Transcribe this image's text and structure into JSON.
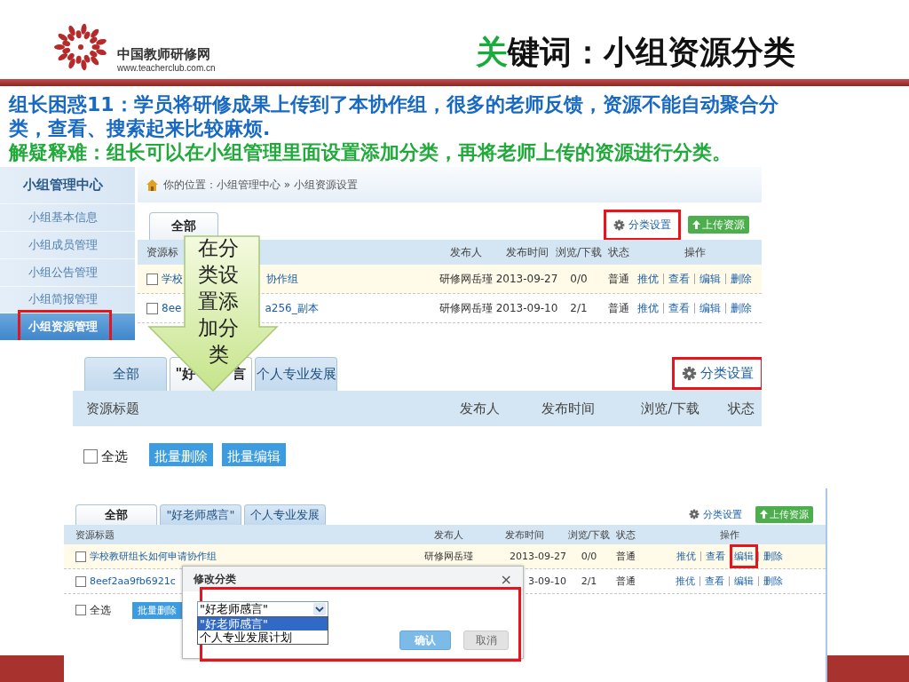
{
  "logo": {
    "name": "中国教师研修网",
    "url": "www.teacherclub.com.cn"
  },
  "title": {
    "highlight": "关",
    "rest": "键词：小组资源分类"
  },
  "notes": [
    {
      "kind": "problem",
      "text": "组长困惑11：学员将研修成果上传到了本协作组，很多的老师反馈，资源不能自动聚合分类，查看、搜索起来比较麻烦."
    },
    {
      "kind": "solution",
      "text": "解疑释难：组长可以在小组管理里面设置添加分类，再将老师上传的资源进行分类。"
    }
  ],
  "shot1": {
    "sidebar": {
      "title": "小组管理中心",
      "items": [
        {
          "label": "小组基本信息",
          "selected": false,
          "highlighted": false
        },
        {
          "label": "小组成员管理",
          "selected": false,
          "highlighted": false
        },
        {
          "label": "小组公告管理",
          "selected": false,
          "highlighted": false
        },
        {
          "label": "小组简报管理",
          "selected": false,
          "highlighted": false
        },
        {
          "label": "小组资源管理",
          "selected": true,
          "highlighted": true
        }
      ]
    },
    "breadcrumb": "你的位置：小组管理中心 » 小组资源设置",
    "tabs": [
      {
        "label_parts": [
          "全部"
        ],
        "selected": true
      }
    ],
    "category_link": {
      "label": "分类设置",
      "highlighted": true
    },
    "upload_button": "上传资源",
    "columns": [
      "资源标",
      "发布人",
      "发布时间",
      "浏览/下载",
      "状态",
      "操作"
    ],
    "rows": [
      {
        "checked": false,
        "hovered": true,
        "title_parts": [
          "学校",
          "协作组"
        ],
        "publisher": "研修网岳瑾",
        "date": "2013-09-27",
        "views": "0/0",
        "status": "普通",
        "actions": [
          {
            "label": "推优",
            "highlighted": false
          },
          {
            "label": "查看",
            "highlighted": false
          },
          {
            "label": "编辑",
            "highlighted": false
          },
          {
            "label": "删除",
            "highlighted": false
          }
        ]
      },
      {
        "checked": false,
        "hovered": false,
        "title_parts": [
          "8ee",
          "a256_副本"
        ],
        "publisher": "研修网岳瑾",
        "date": "2013-09-10",
        "views": "2/1",
        "status": "普通",
        "actions": [
          {
            "label": "推优",
            "highlighted": false
          },
          {
            "label": "查看",
            "highlighted": false
          },
          {
            "label": "编辑",
            "highlighted": false
          },
          {
            "label": "删除",
            "highlighted": false
          }
        ]
      }
    ]
  },
  "shot2": {
    "tabs": [
      {
        "label_parts": [
          "全部"
        ],
        "selected": false
      },
      {
        "label_parts": [
          "\"好",
          "言"
        ],
        "selected": true
      },
      {
        "label_parts": [
          "个人专业发展"
        ],
        "selected": false
      }
    ],
    "category_link": {
      "label": "分类设置",
      "highlighted": true
    },
    "columns": [
      "资源标题",
      "发布人",
      "发布时间",
      "浏览/下载",
      "状态"
    ],
    "select_all": {
      "label": "全选",
      "checked": false
    },
    "bulk_buttons": [
      "批量删除",
      "批量编辑"
    ]
  },
  "shot3": {
    "tabs": [
      {
        "label_parts": [
          "全部"
        ],
        "selected": true
      },
      {
        "label_parts": [
          "\"好老师感言\""
        ],
        "selected": false
      },
      {
        "label_parts": [
          "个人专业发展"
        ],
        "selected": false
      }
    ],
    "category_link": {
      "label": "分类设置",
      "highlighted": false
    },
    "upload_button": "上传资源",
    "columns": [
      "资源标题",
      "发布人",
      "发布时间",
      "浏览/下载",
      "状态",
      "操作"
    ],
    "rows": [
      {
        "checked": false,
        "hovered": true,
        "title": "学校教研组长如何申请协作组",
        "publisher": "研修网岳瑾",
        "date": "2013-09-27",
        "views": "0/0",
        "status": "普通",
        "actions": [
          {
            "label": "推优",
            "highlighted": false
          },
          {
            "label": "查看",
            "highlighted": false
          },
          {
            "label": "编辑",
            "highlighted": true
          },
          {
            "label": "删除",
            "highlighted": false
          }
        ]
      },
      {
        "checked": false,
        "hovered": false,
        "title": "8eef2aa9fb6921c",
        "date": "3-09-10",
        "views": "2/1",
        "status": "普通",
        "actions": [
          {
            "label": "推优",
            "highlighted": false
          },
          {
            "label": "查看",
            "highlighted": false
          },
          {
            "label": "编辑",
            "highlighted": false
          },
          {
            "label": "删除",
            "highlighted": false
          }
        ]
      }
    ],
    "select_all": {
      "label": "全选",
      "checked": false
    },
    "bulk_buttons": [
      "批量删除"
    ],
    "dialog": {
      "title": "修改分类",
      "close": "×",
      "highlighted": true,
      "select": {
        "value": "\"好老师感言\"",
        "options": [
          {
            "label": "\"好老师感言\"",
            "selected": true
          },
          {
            "label": "个人专业发展计划",
            "selected": false
          }
        ]
      },
      "buttons": [
        {
          "label": "确认",
          "kind": "primary"
        },
        {
          "label": "取消",
          "kind": "secondary"
        }
      ]
    }
  },
  "callout": {
    "text": "在分类设置添加分类"
  }
}
